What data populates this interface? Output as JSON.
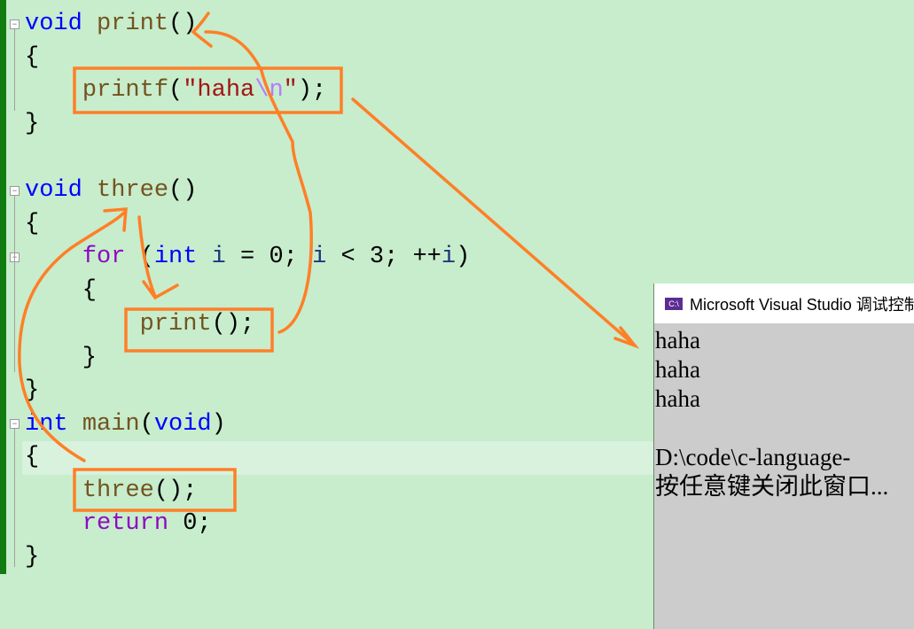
{
  "editor": {
    "lines": [
      [
        "void",
        " ",
        "print",
        "()"
      ],
      [
        "{"
      ],
      [
        "    ",
        "printf",
        "(",
        "\"haha",
        "\\n",
        "\"",
        ");"
      ],
      [
        "}"
      ],
      [
        "void",
        " ",
        "three",
        "()"
      ],
      [
        "{"
      ],
      [
        "    ",
        "for",
        " (",
        "int",
        " ",
        "i",
        " = 0; ",
        "i",
        " < 3; ++",
        "i",
        ")"
      ],
      [
        "    {"
      ],
      [
        "        ",
        "print",
        "();"
      ],
      [
        "    }"
      ],
      [
        "}"
      ],
      [
        "int",
        " ",
        "main",
        "(",
        "void",
        ")"
      ],
      [
        "{"
      ],
      [
        "    ",
        "three",
        "();"
      ],
      [
        "    ",
        "return",
        " 0;"
      ],
      [
        "}"
      ]
    ]
  },
  "console": {
    "title": "Microsoft Visual Studio 调试控制台",
    "icon": "console-app-icon",
    "output": [
      "haha",
      "haha",
      "haha",
      "",
      "D:\\code\\c-language-",
      "按任意键关闭此窗口..."
    ]
  },
  "colors": {
    "annotation": "#ff7f27",
    "keyword": "#0000ff",
    "function": "#74531f",
    "string": "#a31515",
    "console_bg": "#cccccc",
    "editor_bg": "#c7edcc"
  }
}
